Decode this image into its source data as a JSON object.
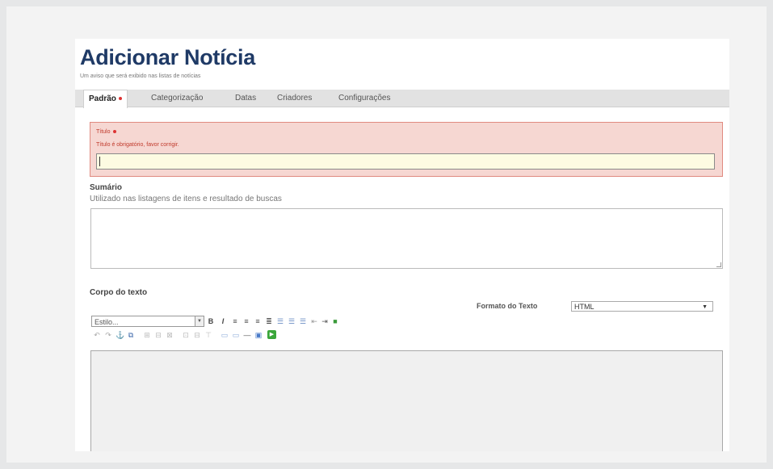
{
  "header": {
    "title": "Adicionar Notícia",
    "subtitle": "Um aviso que será exibido nas listas de notícias"
  },
  "tabs": [
    {
      "label": "Padrão",
      "active": true,
      "required": true
    },
    {
      "label": "Categorização",
      "active": false
    },
    {
      "label": "Datas",
      "active": false
    },
    {
      "label": "Criadores",
      "active": false
    },
    {
      "label": "Configurações",
      "active": false
    }
  ],
  "title_field": {
    "label": "Título",
    "error_message": "Título é obrigatório, favor corrigir.",
    "value": ""
  },
  "summary_field": {
    "label": "Sumário",
    "help": "Utilizado nas listagens de itens e resultado de buscas",
    "value": ""
  },
  "body_field": {
    "label": "Corpo do texto",
    "format_label": "Formato do Texto",
    "format_value": "HTML",
    "style_placeholder": "Estilo..."
  },
  "toolbar_icons": {
    "row1": [
      "bold-icon",
      "italic-icon",
      "align-left-icon",
      "align-center-icon",
      "align-right-icon",
      "align-justify-icon",
      "bullet-list-icon",
      "numbered-list-icon",
      "definition-list-icon",
      "outdent-icon",
      "indent-icon",
      "remove-format-icon"
    ],
    "row2": [
      "undo-icon",
      "redo-icon",
      "anchor-icon",
      "link-icon",
      "table-icon",
      "table-row-icon",
      "table-col-icon",
      "insert-row-icon",
      "delete-row-icon",
      "delete-col-icon",
      "image-icon",
      "box-icon",
      "hr-icon",
      "save-icon",
      "play-icon"
    ]
  },
  "colors": {
    "title": "#1f3a66",
    "error_bg": "#f6d7d2",
    "error_border": "#e08a80",
    "error_text": "#c0392b",
    "input_bg": "#fdfbe2",
    "tab_bar": "#e2e2e2"
  }
}
